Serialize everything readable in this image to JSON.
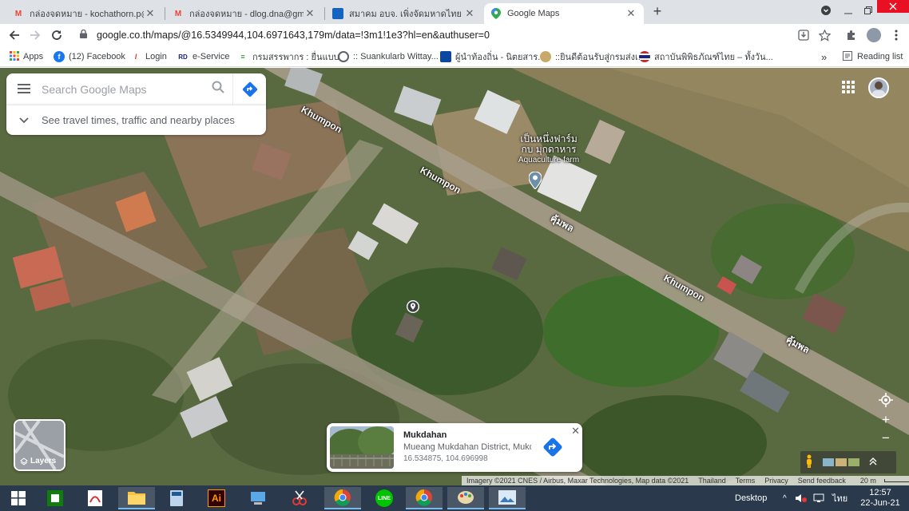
{
  "browser": {
    "tabs": [
      {
        "title": "กล่องจดหมาย - kochathorn.p@gm",
        "icon": "gmail-icon",
        "close": "✕"
      },
      {
        "title": "กล่องจดหมาย - dlog.dna@gmail.cc",
        "icon": "gmail-icon",
        "close": "✕"
      },
      {
        "title": "สมาคม อบจ. เพิ่งจัดมหาดไทย ชักซ้อมแ",
        "icon": "site-icon",
        "close": "✕"
      },
      {
        "title": "Google Maps",
        "icon": "maps-pin-icon",
        "close": "✕"
      }
    ],
    "new_tab": "+",
    "url": "google.co.th/maps/@16.5349944,104.6971643,179m/data=!3m1!1e3?hl=en&authuser=0",
    "bookmarks": [
      {
        "label": "Apps",
        "icon": "apps-grid-icon",
        "color": "#ea4335"
      },
      {
        "label": "(12) Facebook",
        "icon": "facebook-icon",
        "color": "#1877f2"
      },
      {
        "label": "Login",
        "icon": "login-icon",
        "color": "#e53935"
      },
      {
        "label": "e-Service",
        "icon": "eservice-icon",
        "color": "#1a237e"
      },
      {
        "label": "กรมสรรพากร : ยื่นแบบ...",
        "icon": "revenue-dept-icon",
        "color": "#2e7d32"
      },
      {
        "label": ":: Suankularb Wittay...",
        "icon": "school-icon",
        "color": "#5f6368"
      },
      {
        "label": "ผู้นำท้องถิ่น - นิตยสาร...",
        "icon": "magazine-icon",
        "color": "#0d47a1"
      },
      {
        "label": "::ยินดีต้อนรับสู่กรมส่งเ...",
        "icon": "department-icon",
        "color": "#8d6e63"
      },
      {
        "label": "สถาบันพิพิธภัณฑ์ไทย – ทั้งวัน...",
        "icon": "thai-flag-icon",
        "color": "#c62828"
      }
    ],
    "more": "»",
    "reading_list": "Reading list"
  },
  "maps": {
    "search_placeholder": "Search Google Maps",
    "travel_text": "See travel times, traffic and nearby places",
    "road_labels": [
      "Khumpon",
      "Khumpon",
      "คุ้มพล",
      "Khumpon",
      "คุ้มพล"
    ],
    "poi": {
      "thai_name_line1": "เป็นหนึ่งฟาร์ม",
      "thai_name_line2": "กบ มุกดาหาร",
      "english_name": "Aquaculture farm"
    },
    "layers_label": "Layers",
    "place_card": {
      "title": "Mukdahan",
      "subtitle": "Mueang Mukdahan District, Mukd...",
      "coords": "16.534875, 104.696998",
      "close": "✕"
    },
    "zoom_in": "+",
    "zoom_out": "−",
    "attribution": {
      "imagery": "Imagery ©2021 CNES / Airbus, Maxar Technologies, Map data ©2021",
      "country": "Thailand",
      "terms": "Terms",
      "privacy": "Privacy",
      "feedback": "Send feedback",
      "scale": "20 m"
    },
    "colors": {
      "accent_blue": "#1a73e8"
    }
  },
  "taskbar": {
    "desktop": "Desktop",
    "tray_arrow": "^",
    "language": "ไทย",
    "time": "12:57",
    "date": "22-Jun-21"
  }
}
